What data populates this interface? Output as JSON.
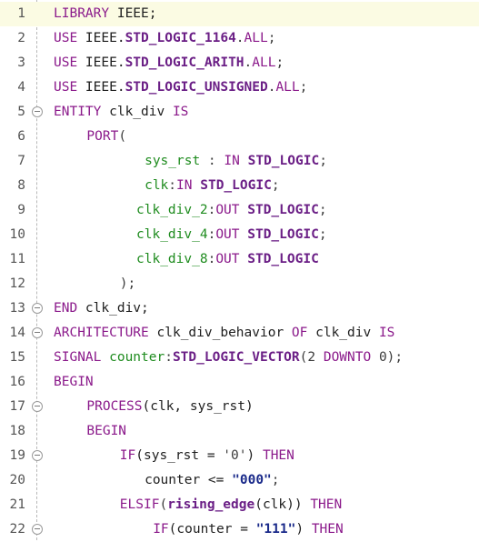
{
  "editor": {
    "lines": [
      {
        "num": "1",
        "fold": false,
        "current": true,
        "indent": 0,
        "tokens": [
          {
            "t": "kw",
            "v": "LIBRARY "
          },
          {
            "t": "id",
            "v": "IEEE;"
          }
        ]
      },
      {
        "num": "2",
        "fold": false,
        "current": false,
        "indent": 0,
        "tokens": [
          {
            "t": "kw",
            "v": "USE "
          },
          {
            "t": "id",
            "v": "IEEE."
          },
          {
            "t": "ty",
            "v": "STD_LOGIC_1164"
          },
          {
            "t": "pu",
            "v": "."
          },
          {
            "t": "kw",
            "v": "ALL"
          },
          {
            "t": "pu",
            "v": ";"
          }
        ]
      },
      {
        "num": "3",
        "fold": false,
        "current": false,
        "indent": 0,
        "tokens": [
          {
            "t": "kw",
            "v": "USE "
          },
          {
            "t": "id",
            "v": "IEEE."
          },
          {
            "t": "ty",
            "v": "STD_LOGIC_ARITH"
          },
          {
            "t": "pu",
            "v": "."
          },
          {
            "t": "kw",
            "v": "ALL"
          },
          {
            "t": "pu",
            "v": ";"
          }
        ]
      },
      {
        "num": "4",
        "fold": false,
        "current": false,
        "indent": 0,
        "tokens": [
          {
            "t": "kw",
            "v": "USE "
          },
          {
            "t": "id",
            "v": "IEEE."
          },
          {
            "t": "ty",
            "v": "STD_LOGIC_UNSIGNED"
          },
          {
            "t": "pu",
            "v": "."
          },
          {
            "t": "kw",
            "v": "ALL"
          },
          {
            "t": "pu",
            "v": ";"
          }
        ]
      },
      {
        "num": "5",
        "fold": true,
        "current": false,
        "indent": 0,
        "tokens": [
          {
            "t": "kw",
            "v": "ENTITY "
          },
          {
            "t": "id",
            "v": "clk_div "
          },
          {
            "t": "kw",
            "v": "IS"
          }
        ]
      },
      {
        "num": "6",
        "fold": false,
        "current": false,
        "indent": 4,
        "tokens": [
          {
            "t": "kw",
            "v": "PORT"
          },
          {
            "t": "pu",
            "v": "("
          }
        ]
      },
      {
        "num": "7",
        "fold": false,
        "current": false,
        "indent": 11,
        "tokens": [
          {
            "t": "po",
            "v": "sys_rst"
          },
          {
            "t": "pu",
            "v": " : "
          },
          {
            "t": "kw",
            "v": "IN "
          },
          {
            "t": "ty",
            "v": "STD_LOGIC"
          },
          {
            "t": "pu",
            "v": ";"
          }
        ]
      },
      {
        "num": "8",
        "fold": false,
        "current": false,
        "indent": 11,
        "tokens": [
          {
            "t": "po",
            "v": "clk"
          },
          {
            "t": "pu",
            "v": ":"
          },
          {
            "t": "kw",
            "v": "IN "
          },
          {
            "t": "ty",
            "v": "STD_LOGIC"
          },
          {
            "t": "pu",
            "v": ";"
          }
        ]
      },
      {
        "num": "9",
        "fold": false,
        "current": false,
        "indent": 10,
        "tokens": [
          {
            "t": "po",
            "v": "clk_div_2"
          },
          {
            "t": "pu",
            "v": ":"
          },
          {
            "t": "kw",
            "v": "OUT "
          },
          {
            "t": "ty",
            "v": "STD_LOGIC"
          },
          {
            "t": "pu",
            "v": ";"
          }
        ]
      },
      {
        "num": "10",
        "fold": false,
        "current": false,
        "indent": 10,
        "tokens": [
          {
            "t": "po",
            "v": "clk_div_4"
          },
          {
            "t": "pu",
            "v": ":"
          },
          {
            "t": "kw",
            "v": "OUT "
          },
          {
            "t": "ty",
            "v": "STD_LOGIC"
          },
          {
            "t": "pu",
            "v": ";"
          }
        ]
      },
      {
        "num": "11",
        "fold": false,
        "current": false,
        "indent": 10,
        "tokens": [
          {
            "t": "po",
            "v": "clk_div_8"
          },
          {
            "t": "pu",
            "v": ":"
          },
          {
            "t": "kw",
            "v": "OUT "
          },
          {
            "t": "ty",
            "v": "STD_LOGIC"
          }
        ]
      },
      {
        "num": "12",
        "fold": false,
        "current": false,
        "indent": 8,
        "tokens": [
          {
            "t": "pu",
            "v": ");"
          }
        ]
      },
      {
        "num": "13",
        "fold": true,
        "current": false,
        "indent": 0,
        "tokens": [
          {
            "t": "kw",
            "v": "END "
          },
          {
            "t": "id",
            "v": "clk_div;"
          }
        ]
      },
      {
        "num": "14",
        "fold": true,
        "current": false,
        "indent": 0,
        "tokens": [
          {
            "t": "kw",
            "v": "ARCHITECTURE "
          },
          {
            "t": "id",
            "v": "clk_div_behavior "
          },
          {
            "t": "kw",
            "v": "OF "
          },
          {
            "t": "id",
            "v": "clk_div "
          },
          {
            "t": "kw",
            "v": "IS"
          }
        ]
      },
      {
        "num": "15",
        "fold": false,
        "current": false,
        "indent": 0,
        "tokens": [
          {
            "t": "kw",
            "v": "SIGNAL "
          },
          {
            "t": "po",
            "v": "counter"
          },
          {
            "t": "pu",
            "v": ":"
          },
          {
            "t": "ty",
            "v": "STD_LOGIC_VECTOR"
          },
          {
            "t": "pu",
            "v": "(2 "
          },
          {
            "t": "kw",
            "v": "DOWNTO "
          },
          {
            "t": "pu",
            "v": "0);"
          }
        ]
      },
      {
        "num": "16",
        "fold": false,
        "current": false,
        "indent": 0,
        "tokens": [
          {
            "t": "kw",
            "v": "BEGIN"
          }
        ]
      },
      {
        "num": "17",
        "fold": true,
        "current": false,
        "indent": 4,
        "tokens": [
          {
            "t": "kw",
            "v": "PROCESS"
          },
          {
            "t": "id",
            "v": "(clk, sys_rst)"
          }
        ]
      },
      {
        "num": "18",
        "fold": false,
        "current": false,
        "indent": 4,
        "tokens": [
          {
            "t": "kw",
            "v": "BEGIN"
          }
        ]
      },
      {
        "num": "19",
        "fold": true,
        "current": false,
        "indent": 8,
        "tokens": [
          {
            "t": "kw",
            "v": "IF"
          },
          {
            "t": "id",
            "v": "(sys_rst = "
          },
          {
            "t": "pu",
            "v": "'0'"
          },
          {
            "t": "id",
            "v": ") "
          },
          {
            "t": "kw",
            "v": "THEN"
          }
        ]
      },
      {
        "num": "20",
        "fold": false,
        "current": false,
        "indent": 11,
        "tokens": [
          {
            "t": "id",
            "v": "counter <= "
          },
          {
            "t": "st",
            "v": "\"000\""
          },
          {
            "t": "pu",
            "v": ";"
          }
        ]
      },
      {
        "num": "21",
        "fold": false,
        "current": false,
        "indent": 8,
        "tokens": [
          {
            "t": "kw",
            "v": "ELSIF"
          },
          {
            "t": "pu",
            "v": "("
          },
          {
            "t": "ty",
            "v": "rising_edge"
          },
          {
            "t": "id",
            "v": "(clk)) "
          },
          {
            "t": "kw",
            "v": "THEN"
          }
        ]
      },
      {
        "num": "22",
        "fold": true,
        "current": false,
        "indent": 12,
        "tokens": [
          {
            "t": "kw",
            "v": "IF"
          },
          {
            "t": "id",
            "v": "(counter = "
          },
          {
            "t": "st",
            "v": "\"111\""
          },
          {
            "t": "id",
            "v": ") "
          },
          {
            "t": "kw",
            "v": "THEN"
          }
        ]
      }
    ]
  }
}
